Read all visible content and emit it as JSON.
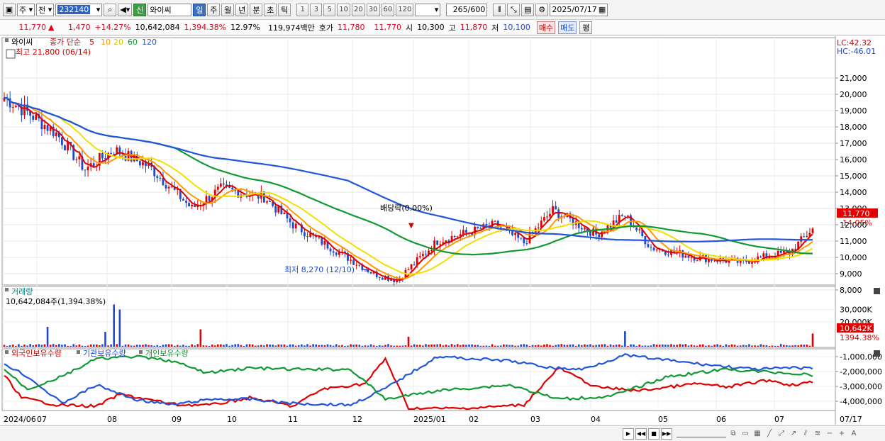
{
  "toolbar": {
    "period_type": "주",
    "price_type": "전",
    "code": "232140",
    "badge": "신",
    "stock_name": "와이씨",
    "periods": [
      "일",
      "주",
      "월",
      "년",
      "분",
      "초",
      "틱"
    ],
    "minutes": [
      "1",
      "3",
      "5",
      "10",
      "20",
      "30",
      "60",
      "120"
    ],
    "count_value": "265",
    "count_total": "/600",
    "date": "2025/07/17"
  },
  "quote": {
    "price": "11,770",
    "arrow": "▲",
    "change": "1,470",
    "change_pct": "+14.27%",
    "volume": "10,642,084",
    "volume_pct": "1,394.38%",
    "turnover": "12.97%",
    "amount": "119,974백만",
    "hoga_label": "호가",
    "ask": "11,780",
    "bid": "11,770",
    "open_label": "시",
    "open": "10,300",
    "high_label": "고",
    "high": "11,870",
    "low_label": "저",
    "low": "10,100",
    "buy_label": "매수",
    "sell_label": "매도",
    "extra_label": "평"
  },
  "price_panel": {
    "name": "와이씨",
    "legend_prefix": "종가 단순",
    "ma_labels": [
      "5",
      "10",
      "20",
      "60",
      "120"
    ],
    "ma_colors": [
      "#e00000",
      "#ff9900",
      "#f0e000",
      "#119933",
      "#2255dd"
    ],
    "high_note": "최고 21,800 (06/14)",
    "low_note": "최저 8,270 (12/10)",
    "dividend_note": "배당락(0.00%)",
    "lc": "LC:42.32",
    "hc": "HC:-46.01",
    "y_ticks": [
      "21,000",
      "20,000",
      "19,000",
      "18,000",
      "17,000",
      "16,000",
      "15,000",
      "14,000",
      "13,000",
      "12,000",
      "11,000",
      "10,000",
      "9,000",
      "8,000"
    ],
    "price_tag": "11,770",
    "pct_tag": "14.05%"
  },
  "volume_panel": {
    "title": "거래량",
    "value_note": "10,642,084주(1,394.38%)",
    "y_ticks": [
      "30,000K",
      "20,000K"
    ],
    "tag_value": "10,642K",
    "tag_pct": "1394.38%"
  },
  "holder_panel": {
    "legend": [
      "외국인보유수량",
      "기관보유수량",
      "개인보유수량"
    ],
    "colors": [
      "#e00000",
      "#2255dd",
      "#119933"
    ],
    "y_ticks": [
      "-1,000,000",
      "-2,000,000",
      "-3,000,000",
      "-4,000,000"
    ]
  },
  "x_axis": {
    "labels": [
      "2024/06",
      "07",
      "08",
      "09",
      "10",
      "11",
      "12",
      "2025/01",
      "02",
      "03",
      "04",
      "05",
      "06",
      "07"
    ],
    "last_date": "07/17"
  },
  "chart_data": {
    "type": "line",
    "series_meta": "candlestick price with simple moving averages, volume bars, holding quantities",
    "y_range": [
      8000,
      21500
    ],
    "low": {
      "value": 8270,
      "date": "12/10"
    },
    "high": {
      "value": 21800,
      "date": "06/14"
    },
    "close": 11770
  }
}
